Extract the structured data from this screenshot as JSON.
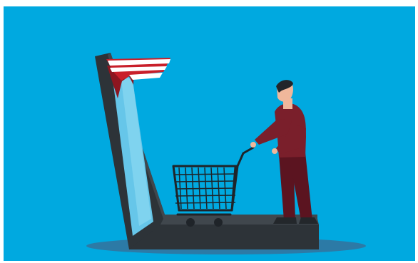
{
  "illustration": {
    "subject": "",
    "colors": {
      "background": "#00a9e0",
      "shadow": "#2c7aa6",
      "device_body": "#2d3338",
      "device_edge": "#40474d",
      "screen_light": "#7fd3ef",
      "screen_mid": "#66c6e9",
      "awning_red": "#c91f2a",
      "awning_dark": "#8d1620",
      "awning_white": "#ffffff",
      "shirt": "#7a1f2b",
      "pants": "#5b1420",
      "skin": "#f0b79b",
      "hair": "#22252a",
      "shoes": "#23272b",
      "cart": "#1f2429"
    },
    "icons": [
      "shopping-cart-icon",
      "store-awning-icon",
      "smartphone-icon",
      "person-icon"
    ]
  }
}
